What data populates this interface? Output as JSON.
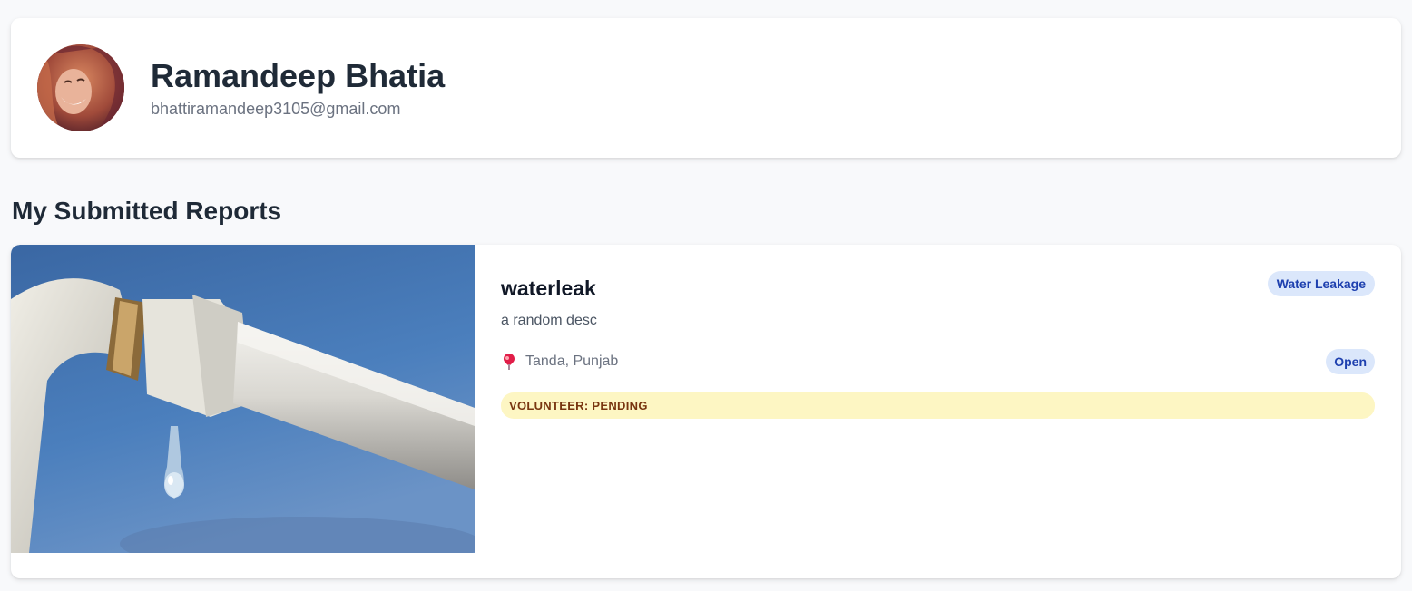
{
  "profile": {
    "name": "Ramandeep Bhatia",
    "email": "bhattiramandeep3105@gmail.com",
    "avatar_icon": "user-avatar-photo"
  },
  "reports_section": {
    "title": "My Submitted Reports"
  },
  "reports": [
    {
      "title": "waterleak",
      "description": "a random desc",
      "category": "Water Leakage",
      "location": "Tanda, Punjab",
      "location_icon": "map-pin-icon",
      "status": "Open",
      "volunteer_status": "VOLUNTEER: PENDING",
      "image_icon": "leaking-pipe-photo"
    }
  ],
  "colors": {
    "background": "#f8f9fb",
    "badge_bg": "#dbe7fb",
    "badge_text": "#1e40af",
    "volunteer_bg": "#fdf6c3",
    "volunteer_text": "#78350f",
    "pin": "#e11d48"
  }
}
